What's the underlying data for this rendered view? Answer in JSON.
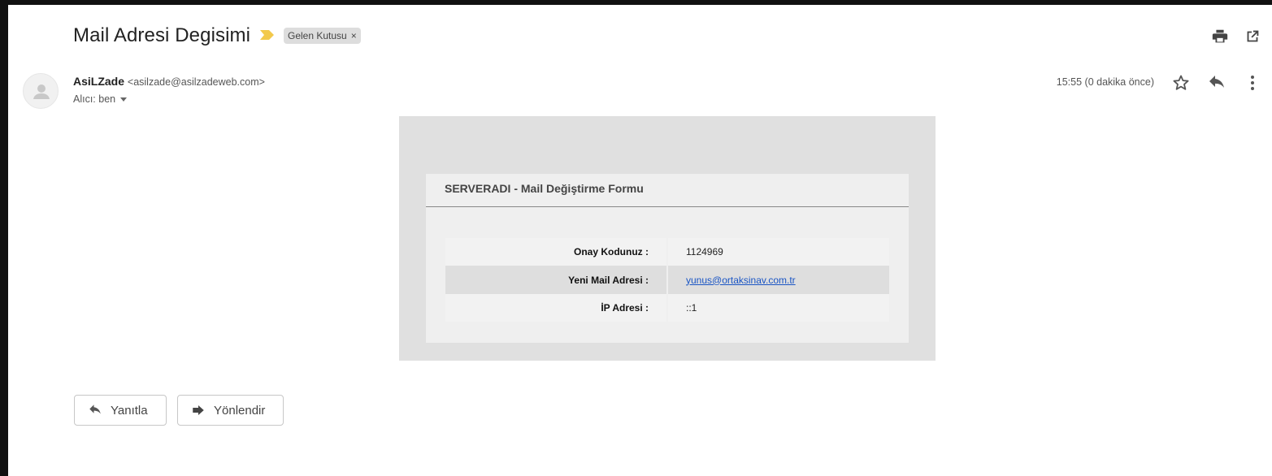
{
  "header": {
    "subject": "Mail Adresi Degisimi",
    "label": "Gelen Kutusu",
    "label_remove": "×",
    "icons": [
      "importance-marker-icon",
      "print-icon",
      "open-in-new-window-icon"
    ]
  },
  "message": {
    "sender_name": "AsiLZade",
    "sender_email": "<asilzade@asilzadeweb.com>",
    "recipient": "Alıcı: ben",
    "time": "15:55 (0 dakika önce)",
    "action_icons": [
      "star-icon",
      "reply-icon",
      "more-options-icon"
    ]
  },
  "email_body": {
    "title": "SERVERADI - Mail Değiştirme Formu",
    "rows": [
      {
        "key": "Onay Kodunuz :",
        "value": "1124969"
      },
      {
        "key": "Yeni Mail Adresi :",
        "value": "yunus@ortaksinav.com.tr"
      },
      {
        "key": "İP Adresi :",
        "value": "::1"
      }
    ]
  },
  "footer": {
    "reply_label": "Yanıtla",
    "forward_label": "Yönlendir"
  },
  "colors": {
    "background": "#ffffff",
    "importance": "#f2c94c",
    "link": "#1a55c4",
    "chip": "#dddddd"
  }
}
